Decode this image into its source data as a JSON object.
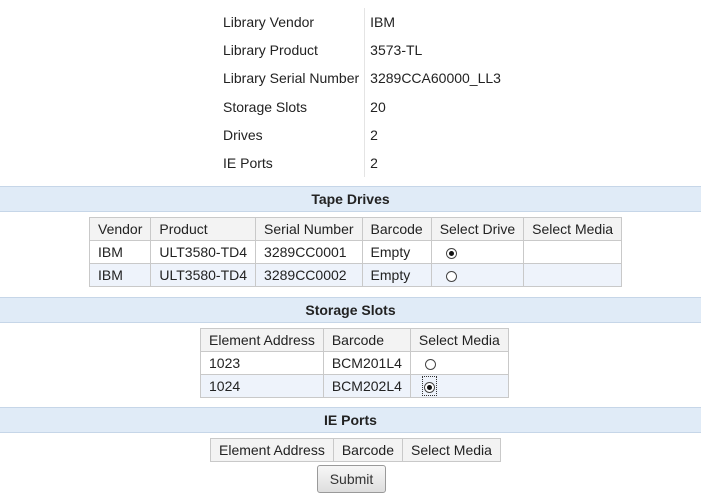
{
  "library_info": [
    {
      "label": "Library Vendor",
      "value": "IBM"
    },
    {
      "label": "Library Product",
      "value": "3573-TL"
    },
    {
      "label": "Library Serial Number",
      "value": "3289CCA60000_LL3"
    },
    {
      "label": "Storage Slots",
      "value": "20"
    },
    {
      "label": "Drives",
      "value": "2"
    },
    {
      "label": "IE Ports",
      "value": "2"
    }
  ],
  "tape_drives": {
    "title": "Tape Drives",
    "columns": [
      "Vendor",
      "Product",
      "Serial Number",
      "Barcode",
      "Select Drive",
      "Select Media"
    ],
    "rows": [
      {
        "vendor": "IBM",
        "product": "ULT3580-TD4",
        "serial": "3289CC0001",
        "barcode": "Empty",
        "select_drive": true
      },
      {
        "vendor": "IBM",
        "product": "ULT3580-TD4",
        "serial": "3289CC0002",
        "barcode": "Empty",
        "select_drive": false
      }
    ]
  },
  "storage_slots": {
    "title": "Storage Slots",
    "columns": [
      "Element Address",
      "Barcode",
      "Select Media"
    ],
    "rows": [
      {
        "address": "1023",
        "barcode": "BCM201L4",
        "select_media": false
      },
      {
        "address": "1024",
        "barcode": "BCM202L4",
        "select_media": true
      }
    ]
  },
  "ie_ports": {
    "title": "IE Ports",
    "columns": [
      "Element Address",
      "Barcode",
      "Select Media"
    ]
  },
  "submit_label": "Submit"
}
